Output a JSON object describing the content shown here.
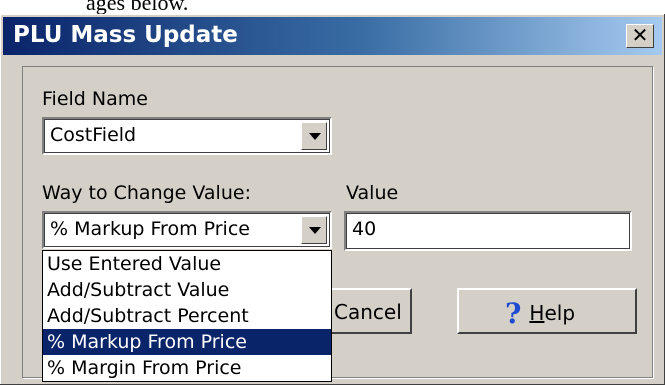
{
  "doc_fragment": "ages below.",
  "window": {
    "title": "PLU Mass Update",
    "close_glyph": "✕"
  },
  "form": {
    "field_name_label": "Field Name",
    "field_name_value": "CostField",
    "way_label": "Way to Change Value:",
    "way_value": "% Markup From Price",
    "value_label": "Value",
    "value_value": "40"
  },
  "dropdown": {
    "items": [
      {
        "label": "Use Entered Value",
        "selected": false
      },
      {
        "label": "Add/Subtract Value",
        "selected": false
      },
      {
        "label": "Add/Subtract Percent",
        "selected": false
      },
      {
        "label": "% Markup From Price",
        "selected": true
      },
      {
        "label": "% Margin From Price",
        "selected": false
      }
    ]
  },
  "buttons": {
    "cancel_label": "Cancel",
    "help_label_mnemonic": "H",
    "help_label_rest": "elp",
    "help_icon": "help-icon"
  },
  "colors": {
    "title_bar_start": "#0a246a",
    "title_bar_end": "#a6caf0",
    "dialog_face": "#d4d0c8",
    "selection": "#0a246a"
  }
}
